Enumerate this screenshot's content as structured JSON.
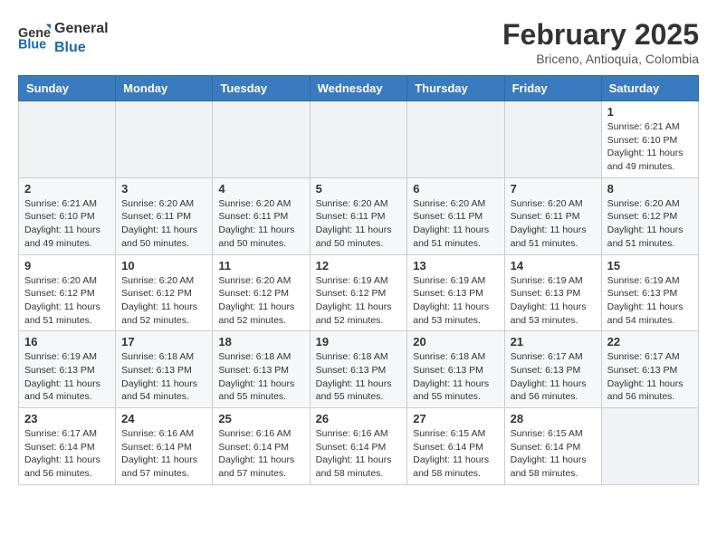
{
  "header": {
    "logo_general": "General",
    "logo_blue": "Blue",
    "month_year": "February 2025",
    "location": "Briceno, Antioquia, Colombia"
  },
  "weekdays": [
    "Sunday",
    "Monday",
    "Tuesday",
    "Wednesday",
    "Thursday",
    "Friday",
    "Saturday"
  ],
  "weeks": [
    [
      {
        "day": "",
        "info": ""
      },
      {
        "day": "",
        "info": ""
      },
      {
        "day": "",
        "info": ""
      },
      {
        "day": "",
        "info": ""
      },
      {
        "day": "",
        "info": ""
      },
      {
        "day": "",
        "info": ""
      },
      {
        "day": "1",
        "info": "Sunrise: 6:21 AM\nSunset: 6:10 PM\nDaylight: 11 hours and 49 minutes."
      }
    ],
    [
      {
        "day": "2",
        "info": "Sunrise: 6:21 AM\nSunset: 6:10 PM\nDaylight: 11 hours and 49 minutes."
      },
      {
        "day": "3",
        "info": "Sunrise: 6:20 AM\nSunset: 6:11 PM\nDaylight: 11 hours and 50 minutes."
      },
      {
        "day": "4",
        "info": "Sunrise: 6:20 AM\nSunset: 6:11 PM\nDaylight: 11 hours and 50 minutes."
      },
      {
        "day": "5",
        "info": "Sunrise: 6:20 AM\nSunset: 6:11 PM\nDaylight: 11 hours and 50 minutes."
      },
      {
        "day": "6",
        "info": "Sunrise: 6:20 AM\nSunset: 6:11 PM\nDaylight: 11 hours and 51 minutes."
      },
      {
        "day": "7",
        "info": "Sunrise: 6:20 AM\nSunset: 6:11 PM\nDaylight: 11 hours and 51 minutes."
      },
      {
        "day": "8",
        "info": "Sunrise: 6:20 AM\nSunset: 6:12 PM\nDaylight: 11 hours and 51 minutes."
      }
    ],
    [
      {
        "day": "9",
        "info": "Sunrise: 6:20 AM\nSunset: 6:12 PM\nDaylight: 11 hours and 51 minutes."
      },
      {
        "day": "10",
        "info": "Sunrise: 6:20 AM\nSunset: 6:12 PM\nDaylight: 11 hours and 52 minutes."
      },
      {
        "day": "11",
        "info": "Sunrise: 6:20 AM\nSunset: 6:12 PM\nDaylight: 11 hours and 52 minutes."
      },
      {
        "day": "12",
        "info": "Sunrise: 6:19 AM\nSunset: 6:12 PM\nDaylight: 11 hours and 52 minutes."
      },
      {
        "day": "13",
        "info": "Sunrise: 6:19 AM\nSunset: 6:13 PM\nDaylight: 11 hours and 53 minutes."
      },
      {
        "day": "14",
        "info": "Sunrise: 6:19 AM\nSunset: 6:13 PM\nDaylight: 11 hours and 53 minutes."
      },
      {
        "day": "15",
        "info": "Sunrise: 6:19 AM\nSunset: 6:13 PM\nDaylight: 11 hours and 54 minutes."
      }
    ],
    [
      {
        "day": "16",
        "info": "Sunrise: 6:19 AM\nSunset: 6:13 PM\nDaylight: 11 hours and 54 minutes."
      },
      {
        "day": "17",
        "info": "Sunrise: 6:18 AM\nSunset: 6:13 PM\nDaylight: 11 hours and 54 minutes."
      },
      {
        "day": "18",
        "info": "Sunrise: 6:18 AM\nSunset: 6:13 PM\nDaylight: 11 hours and 55 minutes."
      },
      {
        "day": "19",
        "info": "Sunrise: 6:18 AM\nSunset: 6:13 PM\nDaylight: 11 hours and 55 minutes."
      },
      {
        "day": "20",
        "info": "Sunrise: 6:18 AM\nSunset: 6:13 PM\nDaylight: 11 hours and 55 minutes."
      },
      {
        "day": "21",
        "info": "Sunrise: 6:17 AM\nSunset: 6:13 PM\nDaylight: 11 hours and 56 minutes."
      },
      {
        "day": "22",
        "info": "Sunrise: 6:17 AM\nSunset: 6:13 PM\nDaylight: 11 hours and 56 minutes."
      }
    ],
    [
      {
        "day": "23",
        "info": "Sunrise: 6:17 AM\nSunset: 6:14 PM\nDaylight: 11 hours and 56 minutes."
      },
      {
        "day": "24",
        "info": "Sunrise: 6:16 AM\nSunset: 6:14 PM\nDaylight: 11 hours and 57 minutes."
      },
      {
        "day": "25",
        "info": "Sunrise: 6:16 AM\nSunset: 6:14 PM\nDaylight: 11 hours and 57 minutes."
      },
      {
        "day": "26",
        "info": "Sunrise: 6:16 AM\nSunset: 6:14 PM\nDaylight: 11 hours and 58 minutes."
      },
      {
        "day": "27",
        "info": "Sunrise: 6:15 AM\nSunset: 6:14 PM\nDaylight: 11 hours and 58 minutes."
      },
      {
        "day": "28",
        "info": "Sunrise: 6:15 AM\nSunset: 6:14 PM\nDaylight: 11 hours and 58 minutes."
      },
      {
        "day": "",
        "info": ""
      }
    ]
  ]
}
